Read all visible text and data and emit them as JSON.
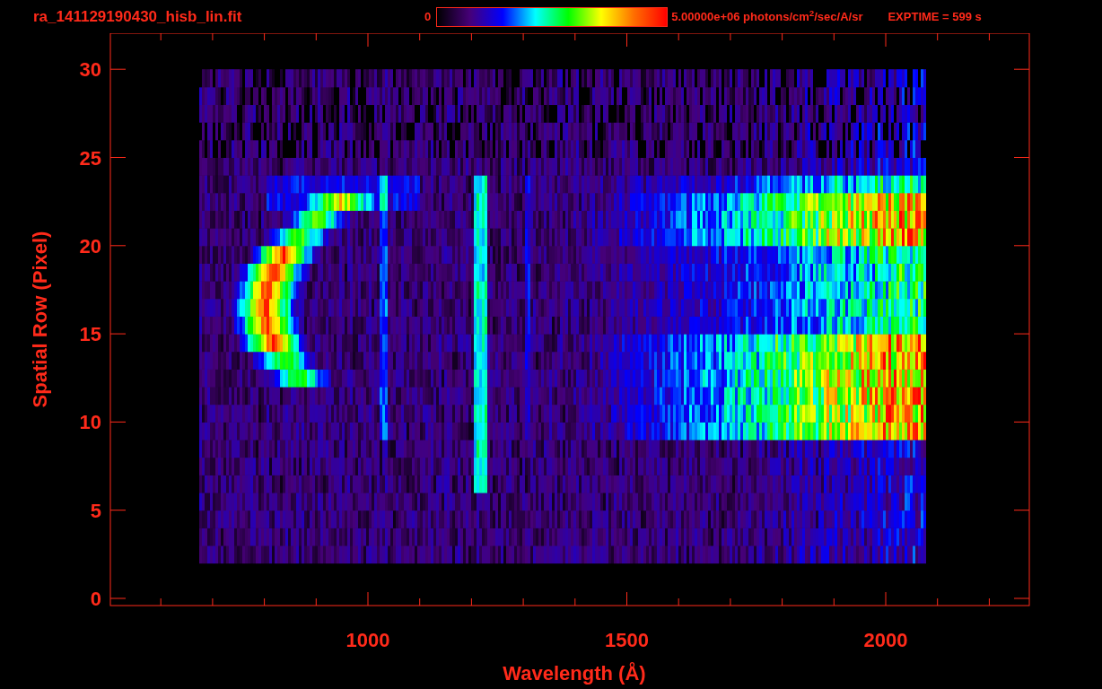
{
  "header": {
    "filename": "ra_141129190430_hisb_lin.fit",
    "colorbar": {
      "min": "0",
      "max": "5.00000e+06 photons/cm$^{2}$/sec/A/sr"
    },
    "exptime": "EXPTIME = 599 s"
  },
  "plot": {
    "ylabel": "Spatial Row (Pixel)",
    "yticks": [
      "30",
      "25",
      "20",
      "15",
      "10",
      "5",
      "0"
    ],
    "xlabel": "Wavelength (Å)",
    "xticks": [
      "1000",
      "1500",
      "2000"
    ]
  }
}
